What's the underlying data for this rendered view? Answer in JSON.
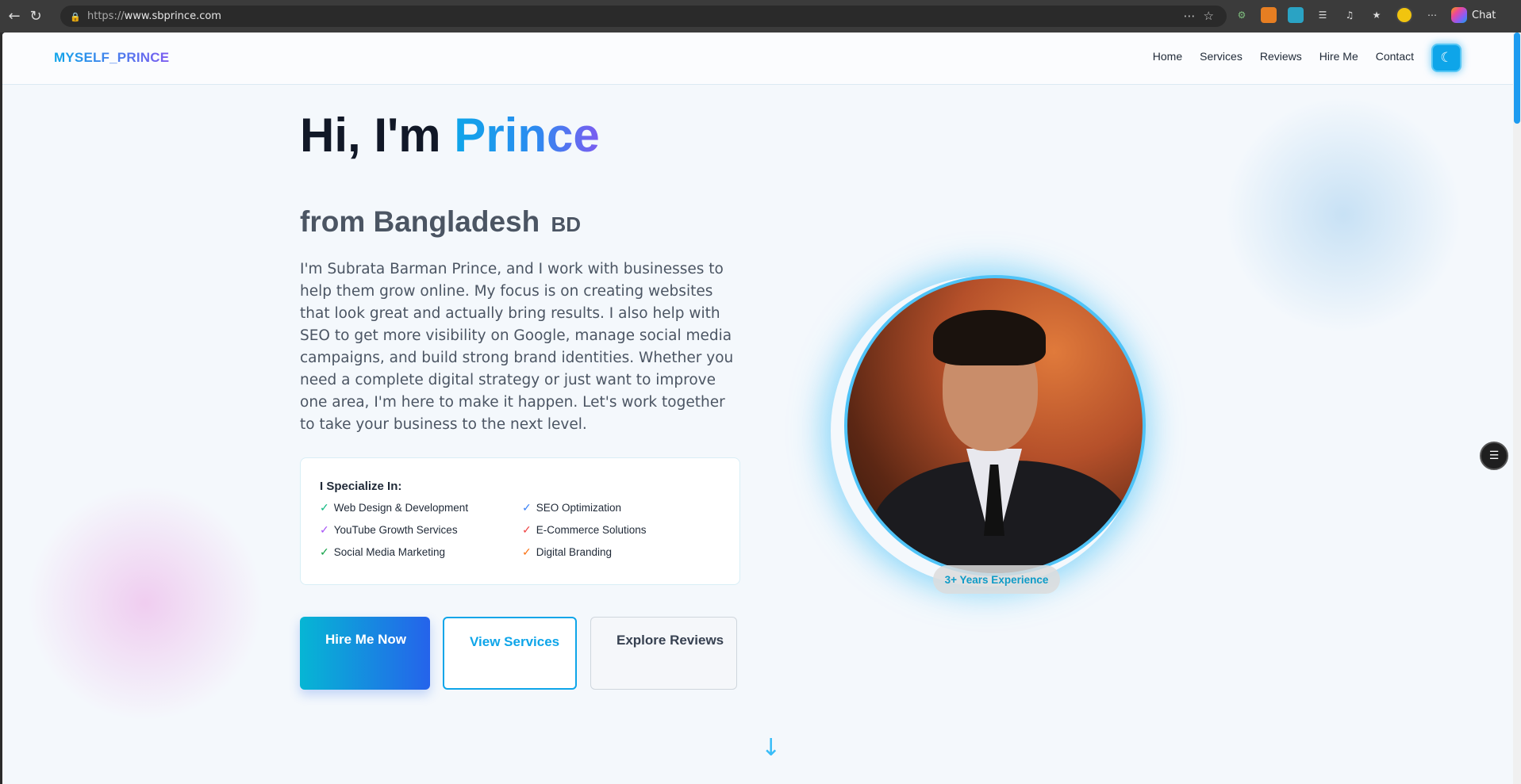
{
  "browser": {
    "url_scheme": "https://",
    "url_host": "www.sbprince.com",
    "chat_label": "Chat"
  },
  "site": {
    "logo": "MYSELF_PRINCE",
    "nav": [
      "Home",
      "Services",
      "Reviews",
      "Hire Me",
      "Contact"
    ],
    "theme_toggle_icon": "moon-icon"
  },
  "hero": {
    "greeting": "Hi, I'm ",
    "name": "Prince",
    "from": "from Bangladesh",
    "country_code": "BD",
    "description": "I'm Subrata Barman Prince, and I work with businesses to help them grow online. My focus is on creating websites that look great and actually bring results. I also help with SEO to get more visibility on Google, manage social media campaigns, and build strong brand identities. Whether you need a complete digital strategy or just want to improve one area, I'm here to make it happen. Let's work together to take your business to the next level.",
    "specialize_title": "I Specialize In:",
    "specialties": [
      {
        "label": "Web Design & Development",
        "color": "#10b981"
      },
      {
        "label": "SEO Optimization",
        "color": "#3b82f6"
      },
      {
        "label": "YouTube Growth Services",
        "color": "#a855f7"
      },
      {
        "label": "E-Commerce Solutions",
        "color": "#ef4444"
      },
      {
        "label": "Social Media Marketing",
        "color": "#16a34a"
      },
      {
        "label": "Digital Branding",
        "color": "#f97316"
      }
    ],
    "buttons": {
      "hire": "Hire Me Now",
      "view": "View Services",
      "reviews": "Explore Reviews"
    },
    "experience_badge": "3+ Years Experience"
  }
}
